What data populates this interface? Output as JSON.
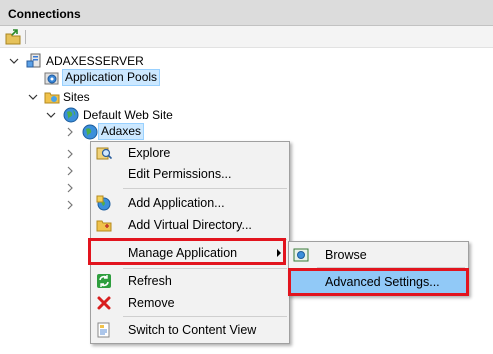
{
  "pane": {
    "title": "Connections"
  },
  "tree": {
    "server": "ADAXESSERVER",
    "app_pools": "Application Pools",
    "sites": "Sites",
    "default_site": "Default Web Site",
    "adaxes": "Adaxes"
  },
  "context_menu": {
    "explore": "Explore",
    "edit_permissions": "Edit Permissions...",
    "add_application": "Add Application...",
    "add_virtual_directory": "Add Virtual Directory...",
    "manage_application": "Manage Application",
    "refresh": "Refresh",
    "remove": "Remove",
    "switch_view": "Switch to Content View"
  },
  "submenu": {
    "browse": "Browse",
    "advanced_settings": "Advanced Settings..."
  },
  "colors": {
    "highlight_border": "#e2141e",
    "selection": "#cce8ff",
    "submenu_hover": "#91c9f7"
  },
  "icons": [
    "connect-icon",
    "server-icon",
    "app-pool-icon",
    "sites-folder-icon",
    "globe-icon",
    "explore-icon",
    "add-application-icon",
    "add-virtual-directory-icon",
    "refresh-icon",
    "remove-icon",
    "content-view-icon",
    "browse-icon"
  ]
}
